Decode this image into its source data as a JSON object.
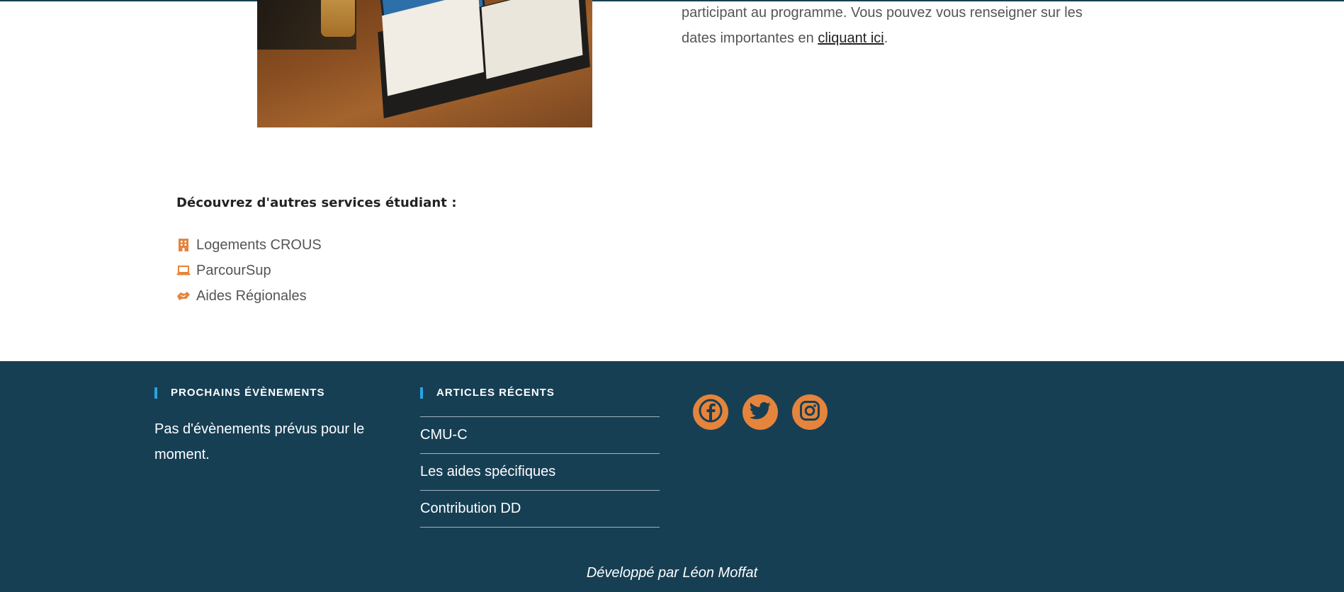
{
  "intro": {
    "line1": "participant au programme.  Vous pouvez vous renseigner sur les",
    "line2_prefix": "dates importantes en ",
    "link": "cliquant ici",
    "line2_suffix": "."
  },
  "services": {
    "heading": "Découvrez d'autres services étudiant :",
    "items": [
      {
        "label": "Logements CROUS",
        "icon": "building-icon"
      },
      {
        "label": "ParcourSup",
        "icon": "laptop-icon"
      },
      {
        "label": "Aides Régionales",
        "icon": "handshake-icon"
      }
    ]
  },
  "footer": {
    "events_title": "PROCHAINS ÉVÈNEMENTS",
    "events_text": "Pas d'évènements prévus pour le moment.",
    "articles_title": "ARTICLES RÉCENTS",
    "articles": [
      "CMU-C",
      "Les aides spécifiques",
      "Contribution DD"
    ],
    "socials": [
      "facebook-icon",
      "twitter-icon",
      "instagram-icon"
    ],
    "credit": "Développé par Léon Moffat"
  },
  "colors": {
    "footer_bg": "#173f54",
    "accent_orange": "#e5843c",
    "accent_blue": "#2aa3e0"
  }
}
